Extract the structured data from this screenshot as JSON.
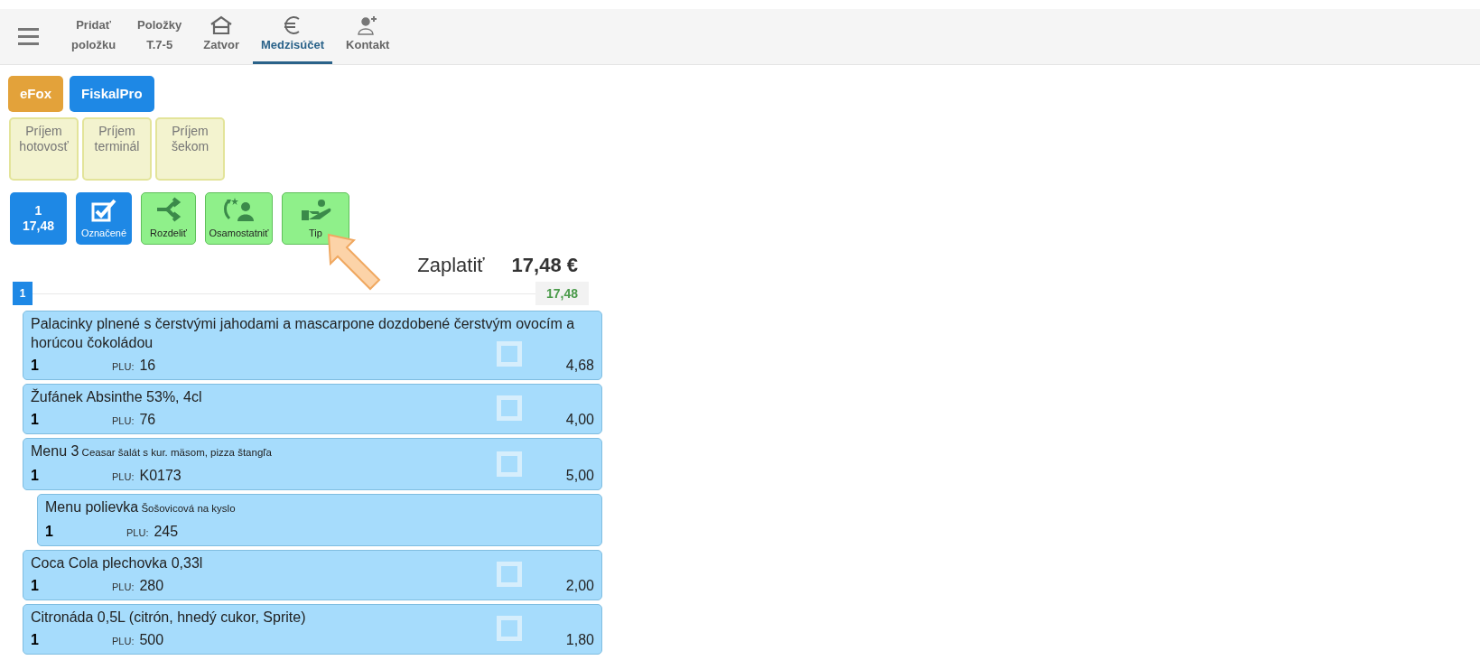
{
  "toolbar": {
    "tabs": [
      {
        "kind": "text",
        "label": "Pridať",
        "sub": "položku",
        "selected": false
      },
      {
        "kind": "text",
        "label": "Položky",
        "sub": "T.7-5",
        "selected": false
      },
      {
        "kind": "house",
        "label": "Zatvor",
        "selected": false
      },
      {
        "kind": "euro",
        "label": "Medzisúčet",
        "selected": true
      },
      {
        "kind": "person",
        "label": "Kontakt",
        "selected": false
      }
    ]
  },
  "systems": [
    {
      "label": "eFox",
      "color": "#e3a23a"
    },
    {
      "label": "FiskalPro",
      "color": "#1e88e5"
    }
  ],
  "payments": [
    {
      "label": "Príjem hotovosť"
    },
    {
      "label": "Príjem terminál"
    },
    {
      "label": "Príjem šekom"
    }
  ],
  "actions": [
    {
      "kind": "count",
      "line1": "1",
      "line2": "17,48"
    },
    {
      "kind": "marked",
      "label": "Označené"
    },
    {
      "kind": "split",
      "label": "Rozdeliť"
    },
    {
      "kind": "separate",
      "label": "Osamostatniť"
    },
    {
      "kind": "tip",
      "label": "Tip"
    }
  ],
  "total": {
    "label": "Zaplatiť",
    "amount": "17,48 €"
  },
  "group": {
    "number": "1",
    "sum": "17,48"
  },
  "items": [
    {
      "kind": "item",
      "name": "Palacinky plnené s čerstvými jahodami a mascarpone dozdobené čerstvým ovocím a horúcou čokoládou",
      "qty": "1",
      "plu_label": "PLU:",
      "plu": "16",
      "price": "4,68",
      "checked": false
    },
    {
      "kind": "item",
      "name": "Žufánek Absinthe 53%, 4cl",
      "qty": "1",
      "plu_label": "PLU:",
      "plu": "76",
      "price": "4,00",
      "checked": false
    },
    {
      "kind": "item",
      "name": "Menu 3",
      "note": "Ceasar šalát s kur. mäsom, pizza štangľa",
      "qty": "1",
      "plu_label": "PLU:",
      "plu": "K0173",
      "price": "5,00",
      "checked": false
    },
    {
      "kind": "subitem",
      "name": "Menu polievka",
      "note": "Šošovicová na kyslo",
      "qty": "1",
      "plu_label": "PLU:",
      "plu": "245"
    },
    {
      "kind": "item",
      "name": "Coca Cola plechovka 0,33l",
      "qty": "1",
      "plu_label": "PLU:",
      "plu": "280",
      "price": "2,00",
      "checked": false
    },
    {
      "kind": "item",
      "name": "Citronáda 0,5L (citrón, hnedý cukor, Sprite)",
      "qty": "1",
      "plu_label": "PLU:",
      "plu": "500",
      "price": "1,80",
      "checked": false
    }
  ]
}
